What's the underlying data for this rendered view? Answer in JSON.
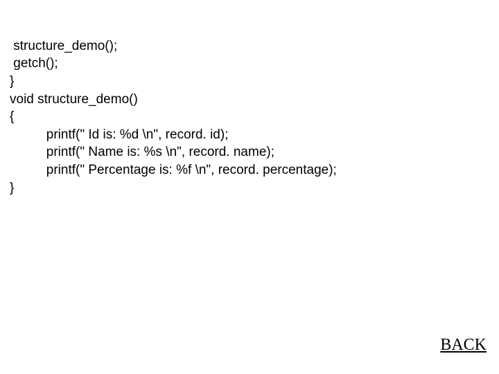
{
  "code": {
    "lines": [
      " structure_demo();",
      " getch();",
      "}",
      "void structure_demo()",
      "{",
      "          printf(\" Id is: %d \\n\", record. id);",
      "          printf(\" Name is: %s \\n\", record. name);",
      "          printf(\" Percentage is: %f \\n\", record. percentage);",
      "}"
    ]
  },
  "nav": {
    "back_label": "BACK"
  }
}
